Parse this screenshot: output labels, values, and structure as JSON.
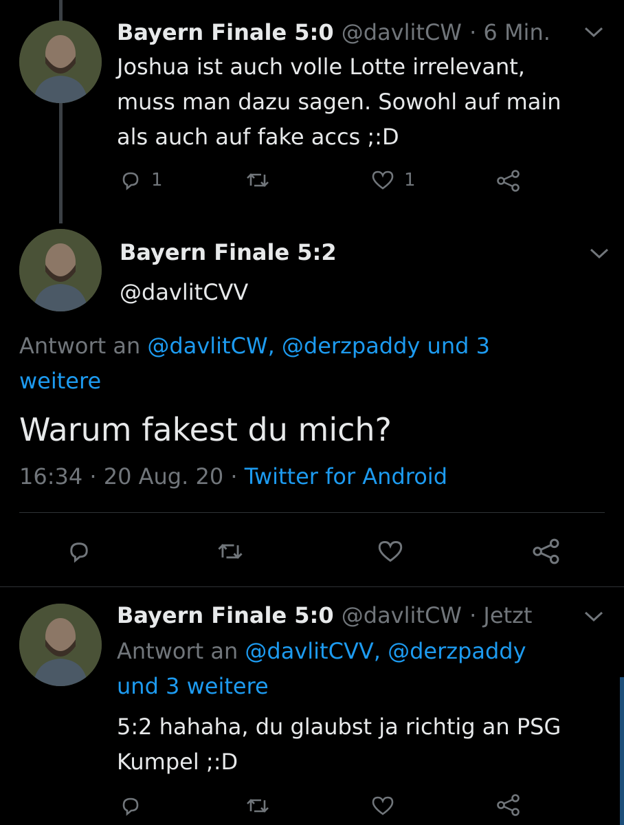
{
  "tweet1": {
    "display_name": "Bayern Finale 5:0",
    "handle": "@davlitCW",
    "time": "· 6 Min.",
    "text_lines": [
      "Joshua ist auch volle Lotte irrelevant,",
      "muss man dazu sagen. Sowohl auf main",
      "als auch auf fake accs ;:D"
    ],
    "reply_count": "1",
    "like_count": "1"
  },
  "focus_tweet": {
    "display_name": "Bayern Finale 5:2",
    "handle": "@davlitCVV",
    "reply_prefix": "Antwort an",
    "reply_to": "@davlitCW, @derzpaddy und 3",
    "reply_to_more": "weitere",
    "text": "Warum fakest du mich?",
    "timestamp": "16:34 · 20 Aug. 20 ·",
    "source": "Twitter for Android"
  },
  "tweet3": {
    "display_name": "Bayern Finale 5:0",
    "handle": "@davlitCW",
    "time": "· Jetzt",
    "reply_prefix": "Antwort an",
    "reply_to": "@davlitCVV, @derzpaddy",
    "reply_to_more": "und 3 weitere",
    "text_lines": [
      "5:2 hahaha, du glaubst ja richtig an PSG",
      "Kumpel ;:D"
    ]
  },
  "icons": [
    "reply-icon",
    "retweet-icon",
    "like-icon",
    "share-icon",
    "chevron-down-icon"
  ],
  "colors": {
    "background": "#000000",
    "text": "#e7e9ea",
    "muted": "#71767b",
    "link": "#1d9bf0"
  }
}
